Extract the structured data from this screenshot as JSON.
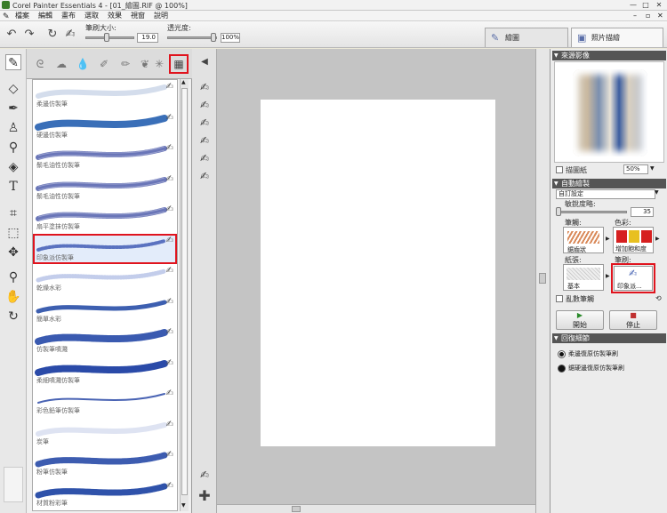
{
  "window": {
    "title": "Corel Painter Essentials 4 - [01_繪圖.RIF @ 100%]"
  },
  "menu": [
    "檔案",
    "編輯",
    "畫布",
    "選取",
    "效果",
    "視窗",
    "說明"
  ],
  "toolbar": {
    "size_label": "筆刷大小:",
    "size_value": "19.0",
    "opacity_label": "透光度:",
    "opacity_value": "100%",
    "tab_draw": "繪圖",
    "tab_photo": "照片描繪"
  },
  "brush_list": [
    {
      "label": "柔邊仿製筆",
      "color": "#b7c6e0",
      "style": "soft",
      "value": 0
    },
    {
      "label": "硬邊仿製筆",
      "color": "#3a6fb8",
      "style": "photo",
      "value": 0
    },
    {
      "label": "鬃毛油性仿製筆",
      "color": "#6a76b8",
      "style": "lines",
      "value": 0
    },
    {
      "label": "鬃毛油性仿製筆",
      "color": "#6a76b8",
      "style": "lines",
      "value": 0
    },
    {
      "label": "扇平塗抹仿製筆",
      "color": "#6a76b8",
      "style": "lines",
      "value": 0
    },
    {
      "label": "印象派仿製筆",
      "color": "#5a72c0",
      "style": "impress",
      "value": 0
    },
    {
      "label": "乾燥水彩",
      "color": "#a9b8e2",
      "style": "dots",
      "value": 0
    },
    {
      "label": "簡單水彩",
      "color": "#3d5fb0",
      "style": "solid",
      "value": 0
    },
    {
      "label": "仿製筆噴濺",
      "color": "#3a5ab0",
      "style": "splat",
      "value": 0
    },
    {
      "label": "柔細噴濺仿製筆",
      "color": "#2a4aa8",
      "style": "splat",
      "value": 0
    },
    {
      "label": "彩色鉛筆仿製筆",
      "color": "#4a64b4",
      "style": "thin",
      "value": 0
    },
    {
      "label": "炭筆",
      "color": "#c8d0ea",
      "style": "soft",
      "value": 0
    },
    {
      "label": "粉筆仿製筆",
      "color": "#3d5cb0",
      "style": "chalk",
      "value": 0
    },
    {
      "label": "材質粉彩筆",
      "color": "#2f52aa",
      "style": "chalk",
      "value": 0
    }
  ],
  "right": {
    "source_header": "來源影像",
    "trace_label": "描圖紙",
    "zoom": "50%",
    "auto_header": "自動繪製",
    "preset": "自訂設定",
    "sensitivity_label": "敏銳度略:",
    "sensitivity_value": "35",
    "stroke_label": "筆觸:",
    "stroke_value": "鋸齒狀",
    "color_label": "色彩:",
    "color_value": "增加飽和度",
    "paper_label": "紙張:",
    "paper_value": "基本",
    "brush_label": "筆刷:",
    "brush_value": "印象派...",
    "random_label": "亂數筆觸",
    "start_label": "開始",
    "stop_label": "停止",
    "detail_header": "回復細節",
    "option1": "柔邊復原仿製筆刷",
    "option2": "鋸硬邊復原仿製筆刷"
  }
}
